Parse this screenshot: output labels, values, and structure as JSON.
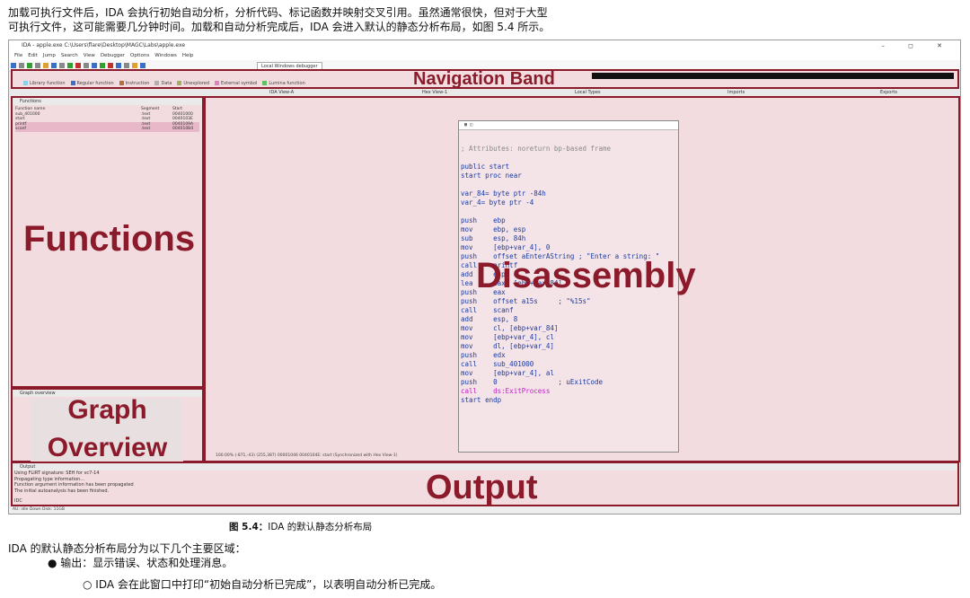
{
  "intro_lines": [
    "加载可执行文件后，IDA 会执行初始自动分析，分析代码、标记函数并映射交叉引用。虽然通常很快，但对于大型",
    "可执行文件，这可能需要几分钟时间。加载和自动分析完成后，IDA 会进入默认的静态分析布局，如图 5.4 所示。"
  ],
  "window": {
    "title": "IDA - apple.exe C:\\Users\\flare\\Desktop\\MAGC\\Labs\\apple.exe",
    "controls": "–  ◻  ✕",
    "menu": [
      "File",
      "Edit",
      "Jump",
      "Search",
      "View",
      "Debugger",
      "Options",
      "Windows",
      "Help"
    ],
    "debugger_select": "Local Windows debugger",
    "legend": [
      {
        "label": "Library function",
        "color": "#8ad0e8"
      },
      {
        "label": "Regular function",
        "color": "#3a6fc8"
      },
      {
        "label": "Instruction",
        "color": "#b07040"
      },
      {
        "label": "Data",
        "color": "#b0b0b0"
      },
      {
        "label": "Unexplored",
        "color": "#a0b060"
      },
      {
        "label": "External symbol",
        "color": "#e080c0"
      },
      {
        "label": "Lumina function",
        "color": "#60c060"
      }
    ],
    "tabs": [
      "IDA View-A",
      "Hex View-1",
      "Local Types",
      "Imports",
      "Exports"
    ],
    "functions_panel_title": "Functions",
    "functions_columns": [
      "Function name",
      "Segment",
      "Start"
    ],
    "functions": [
      {
        "name": "sub_401000",
        "segment": ".text",
        "start": "00401000",
        "highlight": false
      },
      {
        "name": "start",
        "segment": ".text",
        "start": "0040103E",
        "highlight": false
      },
      {
        "name": "printf",
        "segment": ".text",
        "start": "0040109A",
        "highlight": true
      },
      {
        "name": "scanf",
        "segment": ".text",
        "start": "004010B4",
        "highlight": true
      }
    ],
    "graph_panel_title": "Graph overview",
    "output_panel_title": "Output",
    "output_lines": [
      "Using FLIRT signature: SEH for vc7-14",
      "Propagating type information...",
      "Function argument information has been propagated",
      "The initial autoanalysis has been finished."
    ],
    "output_prompt": "IDC",
    "status_text": "AU:  idle   Down       Disk: 11GB",
    "disasm_status": "100.00% (-871,-43) (255,387) 00001046 0040104E: start (Synchronized with Hex View-1)"
  },
  "overlay_labels": {
    "navigation": "Navigation Band",
    "functions": "Functions",
    "graph_overview": "Graph\nOverview",
    "disassembly": "Disassembly",
    "output": "Output"
  },
  "code_lines": [
    {
      "t": "; Attributes: noreturn bp-based frame",
      "c": "cm"
    },
    {
      "t": "",
      "c": ""
    },
    {
      "t": "public start",
      "c": ""
    },
    {
      "t": "start proc near",
      "c": ""
    },
    {
      "t": "",
      "c": ""
    },
    {
      "t": "var_84= byte ptr -84h",
      "c": ""
    },
    {
      "t": "var_4= byte ptr -4",
      "c": ""
    },
    {
      "t": "",
      "c": ""
    },
    {
      "t": "push    ebp",
      "c": ""
    },
    {
      "t": "mov     ebp, esp",
      "c": ""
    },
    {
      "t": "sub     esp, 84h",
      "c": ""
    },
    {
      "t": "mov     [ebp+var_4], 0",
      "c": ""
    },
    {
      "t": "push    offset aEnterAString ; \"Enter a string: \"",
      "c": ""
    },
    {
      "t": "call    printf",
      "c": ""
    },
    {
      "t": "add     esp, 4",
      "c": ""
    },
    {
      "t": "lea     eax, [ebp+var_84]",
      "c": ""
    },
    {
      "t": "push    eax",
      "c": ""
    },
    {
      "t": "push    offset a15s     ; \"%15s\"",
      "c": ""
    },
    {
      "t": "call    scanf",
      "c": ""
    },
    {
      "t": "add     esp, 8",
      "c": ""
    },
    {
      "t": "mov     cl, [ebp+var_84]",
      "c": ""
    },
    {
      "t": "mov     [ebp+var_4], cl",
      "c": ""
    },
    {
      "t": "mov     dl, [ebp+var_4]",
      "c": ""
    },
    {
      "t": "push    edx",
      "c": ""
    },
    {
      "t": "call    sub_401000",
      "c": ""
    },
    {
      "t": "mov     [ebp+var_4], al",
      "c": ""
    },
    {
      "t": "push    0               ; uExitCode",
      "c": ""
    },
    {
      "t": "call    ds:ExitProcess",
      "c": "mg"
    },
    {
      "t": "start endp",
      "c": ""
    }
  ],
  "caption": {
    "label": "图 5.4：",
    "text": "IDA 的默认静态分析布局"
  },
  "section_line": "IDA 的默认静态分析布局分为以下几个主要区域：",
  "bullet": "● 输出：显示错误、状态和处理消息。",
  "sub_bullet": "○ IDA 会在此窗口中打印“初始自动分析已完成”，以表明自动分析已完成。",
  "colors": {
    "accent": "#8b1a2b",
    "panel_fill": "#f2dcdf",
    "code_text": "#1a3aa0"
  }
}
